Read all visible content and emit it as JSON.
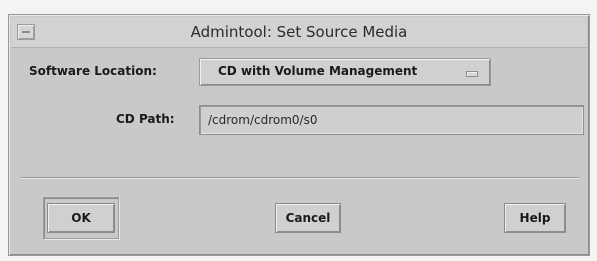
{
  "window": {
    "title": "Admintool: Set Source Media"
  },
  "form": {
    "software_location_label": "Software Location:",
    "software_location_value": "CD with Volume Management",
    "cd_path_label": "CD Path:",
    "cd_path_value": "/cdrom/cdrom0/s0"
  },
  "buttons": {
    "ok": "OK",
    "cancel": "Cancel",
    "help": "Help"
  },
  "icons": {
    "window_menu": "window-menu-icon",
    "option_indicator": "option-menu-indicator-icon"
  }
}
